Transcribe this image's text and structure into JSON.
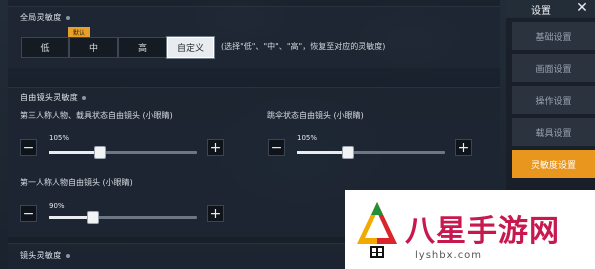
{
  "global": {
    "title": "全局灵敏度",
    "options": [
      "低",
      "中",
      "高",
      "自定义"
    ],
    "selected": "自定义",
    "recommend_badge": "默认",
    "hint": "(选择\"低\"、\"中\"、\"高\"，恢复至对应的灵敏度)"
  },
  "free_cam": {
    "title": "自由镜头灵敏度",
    "third_person": {
      "label": "第三人称人物、载具状态自由镜头 (小眼睛)",
      "value_text": "105%",
      "value": 105
    },
    "parachute": {
      "label": "跳伞状态自由镜头 (小眼睛)",
      "value_text": "105%",
      "value": 105
    },
    "first_person": {
      "label": "第一人称人物自由镜头 (小眼睛)",
      "value_text": "90%",
      "value": 90
    },
    "minus_label": "−",
    "plus_label": "+"
  },
  "lens": {
    "title": "镜头灵敏度"
  },
  "sidebar": {
    "title": "设置",
    "close_label": "✕",
    "items": [
      "基础设置",
      "画面设置",
      "操作设置",
      "载具设置",
      "灵敏度设置"
    ],
    "active": "灵敏度设置"
  },
  "watermark": {
    "text": "八星手游网",
    "url": "lyshbx.com"
  },
  "colors": {
    "accent": "#e9961f",
    "badge": "#e9a02a",
    "watermark": "#c7194f"
  }
}
